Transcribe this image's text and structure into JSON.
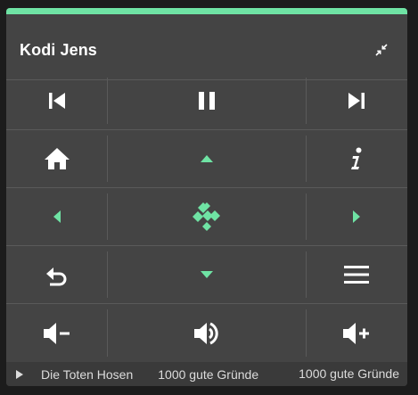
{
  "widget": {
    "title": "Kodi Jens"
  },
  "colors": {
    "accent": "#6fe3a4",
    "card_background": "#444444",
    "page_background": "#1c1c1c",
    "icon_white": "#ffffff"
  },
  "controls": {
    "row1": [
      "skip-previous-icon",
      "pause-icon",
      "skip-next-icon"
    ],
    "row2": [
      "home-icon",
      "arrow-up-icon",
      "info-icon"
    ],
    "row3": [
      "arrow-left-icon",
      "kodi-logo-icon",
      "arrow-right-icon"
    ],
    "row4": [
      "back-icon",
      "arrow-down-icon",
      "menu-icon"
    ],
    "row5": [
      "volume-down-icon",
      "volume-icon",
      "volume-up-icon"
    ]
  },
  "now_playing": {
    "artist": "Die Toten Hosen",
    "album": "1000 gute Gründe",
    "track": "1000 gute Gründe"
  }
}
